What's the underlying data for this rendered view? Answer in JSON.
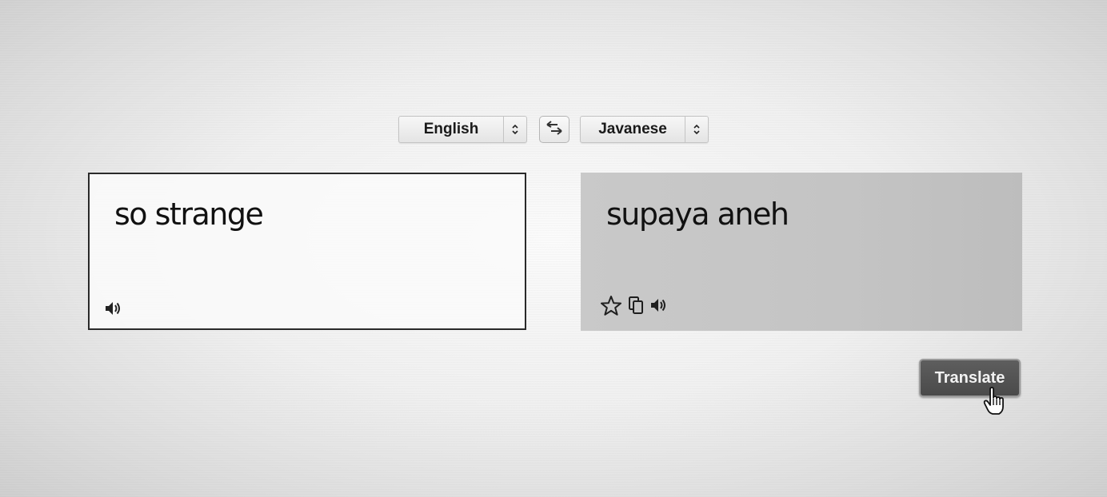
{
  "language_bar": {
    "source_language": "English",
    "target_language": "Javanese",
    "swap_icon": "swap-arrows-icon",
    "select_icon": "up-down-chevron-icon"
  },
  "source": {
    "text": "so strange",
    "speaker_icon": "speaker-icon"
  },
  "target": {
    "text": "supaya aneh",
    "icons": [
      "star-icon",
      "copy-icon",
      "speaker-icon"
    ]
  },
  "translate_button": {
    "label": "Translate"
  },
  "cursor_icon": "hand-pointer-icon",
  "colors": {
    "button_bg": "#505050",
    "target_panel_bg": "#c6c6c6",
    "source_border": "#2a2a2a"
  }
}
